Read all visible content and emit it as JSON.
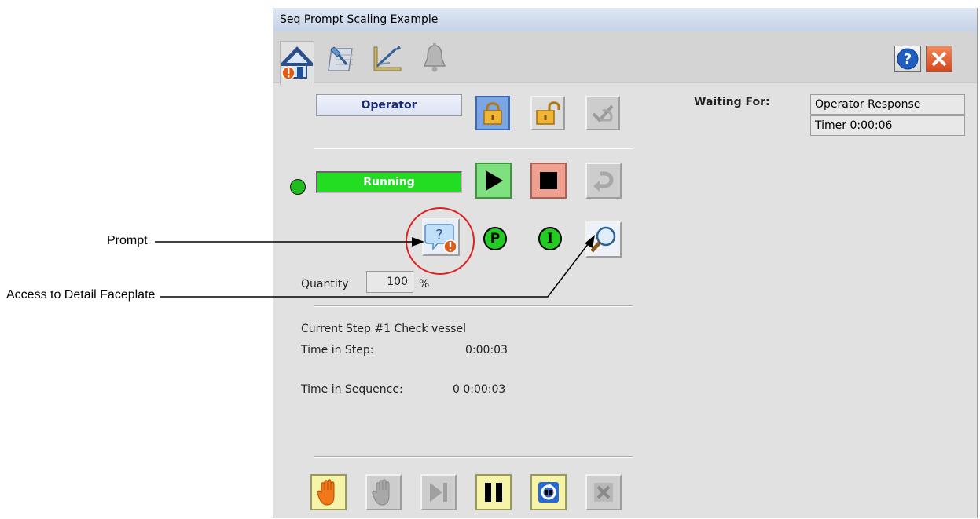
{
  "callouts": {
    "prompt": "Prompt",
    "access_detail": "Access to Detail Faceplate"
  },
  "window": {
    "title": "Seq Prompt Scaling Example"
  },
  "tabs": [
    {
      "name": "home",
      "icon": "home-alarm-icon",
      "active": true
    },
    {
      "name": "maintenance",
      "icon": "maintenance-icon"
    },
    {
      "name": "engineering",
      "icon": "engineering-icon"
    },
    {
      "name": "alarms",
      "icon": "bell-icon"
    }
  ],
  "header_buttons": {
    "help_icon": "help-icon",
    "close_icon": "close-icon"
  },
  "access": {
    "mode": "Operator"
  },
  "status": {
    "state": "Running",
    "state_color": "#22dd22",
    "indicator_color": "#22bb22"
  },
  "indicators": {
    "p": "P",
    "i": "I"
  },
  "quantity": {
    "label": "Quantity",
    "value": "100",
    "unit": "%"
  },
  "step": {
    "current": "Current Step #1 Check vessel",
    "time_in_step_label": "Time in Step:",
    "time_in_step": "0:00:03",
    "time_in_seq_label": "Time in Sequence:",
    "time_in_seq": "0 0:00:03"
  },
  "waiting": {
    "label": "Waiting For:",
    "items": [
      "Operator Response",
      "Timer 0:00:06"
    ]
  }
}
